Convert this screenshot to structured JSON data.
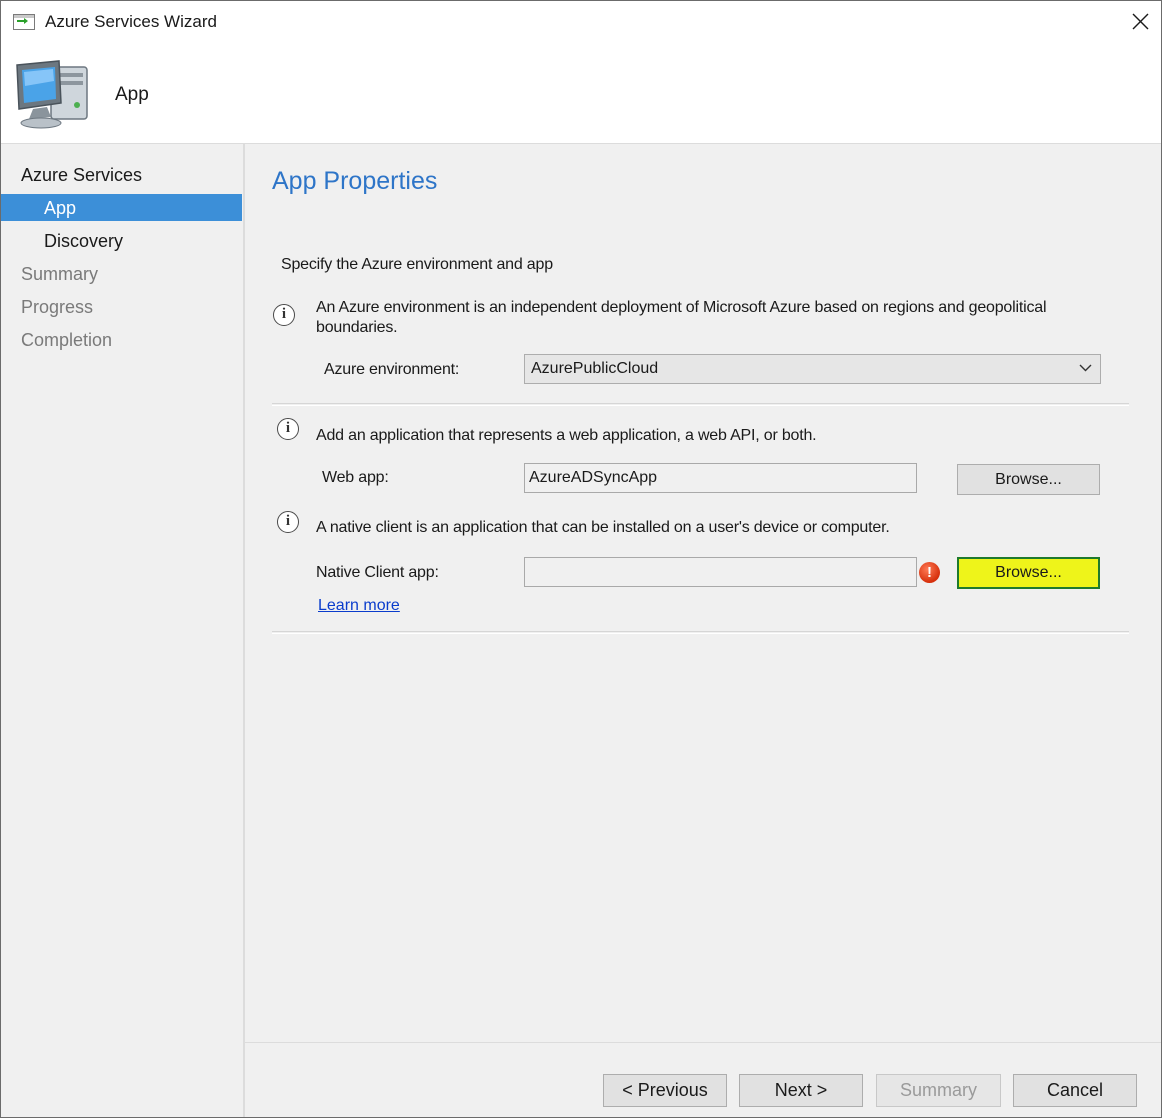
{
  "window": {
    "title": "Azure Services Wizard"
  },
  "header": {
    "title": "App"
  },
  "nav": {
    "items": [
      {
        "label": "Azure Services"
      },
      {
        "label": "App"
      },
      {
        "label": "Discovery"
      },
      {
        "label": "Summary"
      },
      {
        "label": "Progress"
      },
      {
        "label": "Completion"
      }
    ],
    "selected": "App"
  },
  "main": {
    "page_title": "App Properties",
    "instruction": "Specify the Azure environment and app",
    "environment": {
      "info_line1": "An Azure environment is an independent deployment of Microsoft Azure based on regions and geopolitical",
      "info_line2": "boundaries.",
      "label": "Azure environment:",
      "value": "AzurePublicCloud"
    },
    "web_app": {
      "info": "Add an application that represents a web application, a web API, or both.",
      "label": "Web app:",
      "value": "AzureADSyncApp",
      "browse_label": "Browse..."
    },
    "native_app": {
      "info": "A native client is an application that can be installed on a user's device or computer.",
      "label": "Native Client app:",
      "value": "",
      "browse_label": "Browse...",
      "error_glyph": "!"
    },
    "learn_more": "Learn more"
  },
  "footer": {
    "previous": "< Previous",
    "next": "Next >",
    "summary": "Summary",
    "cancel": "Cancel"
  },
  "icons": {
    "title": "wizard-window-icon",
    "close": "close-icon",
    "header": "computer-icon",
    "info": "info-icon",
    "error": "error-icon",
    "dropdown": "chevron-down-icon"
  },
  "colors": {
    "accent": "#2e75c8",
    "nav_selected": "#3c8fd8",
    "highlight": "#eef41a",
    "link": "#0a3ccc",
    "error": "#d6300c"
  }
}
